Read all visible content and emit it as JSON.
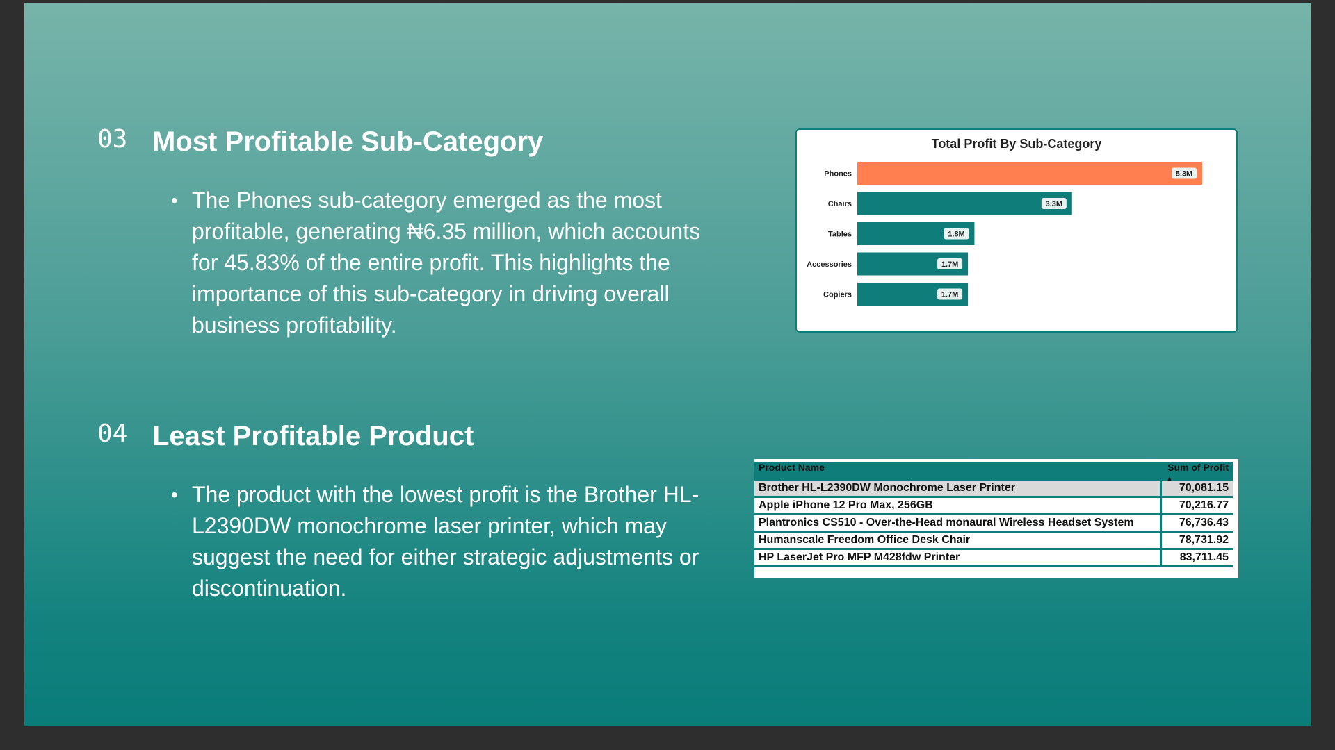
{
  "sections": [
    {
      "number": "03",
      "title": "Most Profitable Sub-Category",
      "bullet": "The Phones sub-category emerged as the most profitable, generating ₦6.35 million, which accounts for 45.83% of the entire profit. This highlights the importance of this sub-category in driving overall business profitability."
    },
    {
      "number": "04",
      "title": "Least Profitable Product",
      "bullet": "The product with the lowest profit is the Brother HL-L2390DW monochrome laser printer, which may suggest the need for either strategic adjustments or discontinuation."
    }
  ],
  "chart_data": {
    "type": "bar",
    "orientation": "horizontal",
    "title": "Total Profit By Sub-Category",
    "categories": [
      "Phones",
      "Chairs",
      "Tables",
      "Accessories",
      "Copiers"
    ],
    "values": [
      5.3,
      3.3,
      1.8,
      1.7,
      1.7
    ],
    "data_labels": [
      "5.3M",
      "3.3M",
      "1.8M",
      "1.7M",
      "1.7M"
    ],
    "unit": "M",
    "colors": [
      "#ff7f50",
      "#0f7e7a",
      "#0f7e7a",
      "#0f7e7a",
      "#0f7e7a"
    ],
    "xlim": [
      0,
      5.3
    ],
    "grid": false
  },
  "table": {
    "headers": [
      "Product Name",
      "Sum of Profit"
    ],
    "sort_icon": "sort-ascending-icon",
    "rows": [
      [
        "Brother HL-L2390DW Monochrome Laser Printer",
        "70,081.15"
      ],
      [
        "Apple iPhone 12 Pro Max, 256GB",
        "70,216.77"
      ],
      [
        "Plantronics CS510 - Over-the-Head monaural Wireless Headset System",
        "76,736.43"
      ],
      [
        "Humanscale Freedom Office Desk Chair",
        "78,731.92"
      ],
      [
        "HP LaserJet Pro MFP M428fdw Printer",
        "83,711.45"
      ]
    ]
  }
}
